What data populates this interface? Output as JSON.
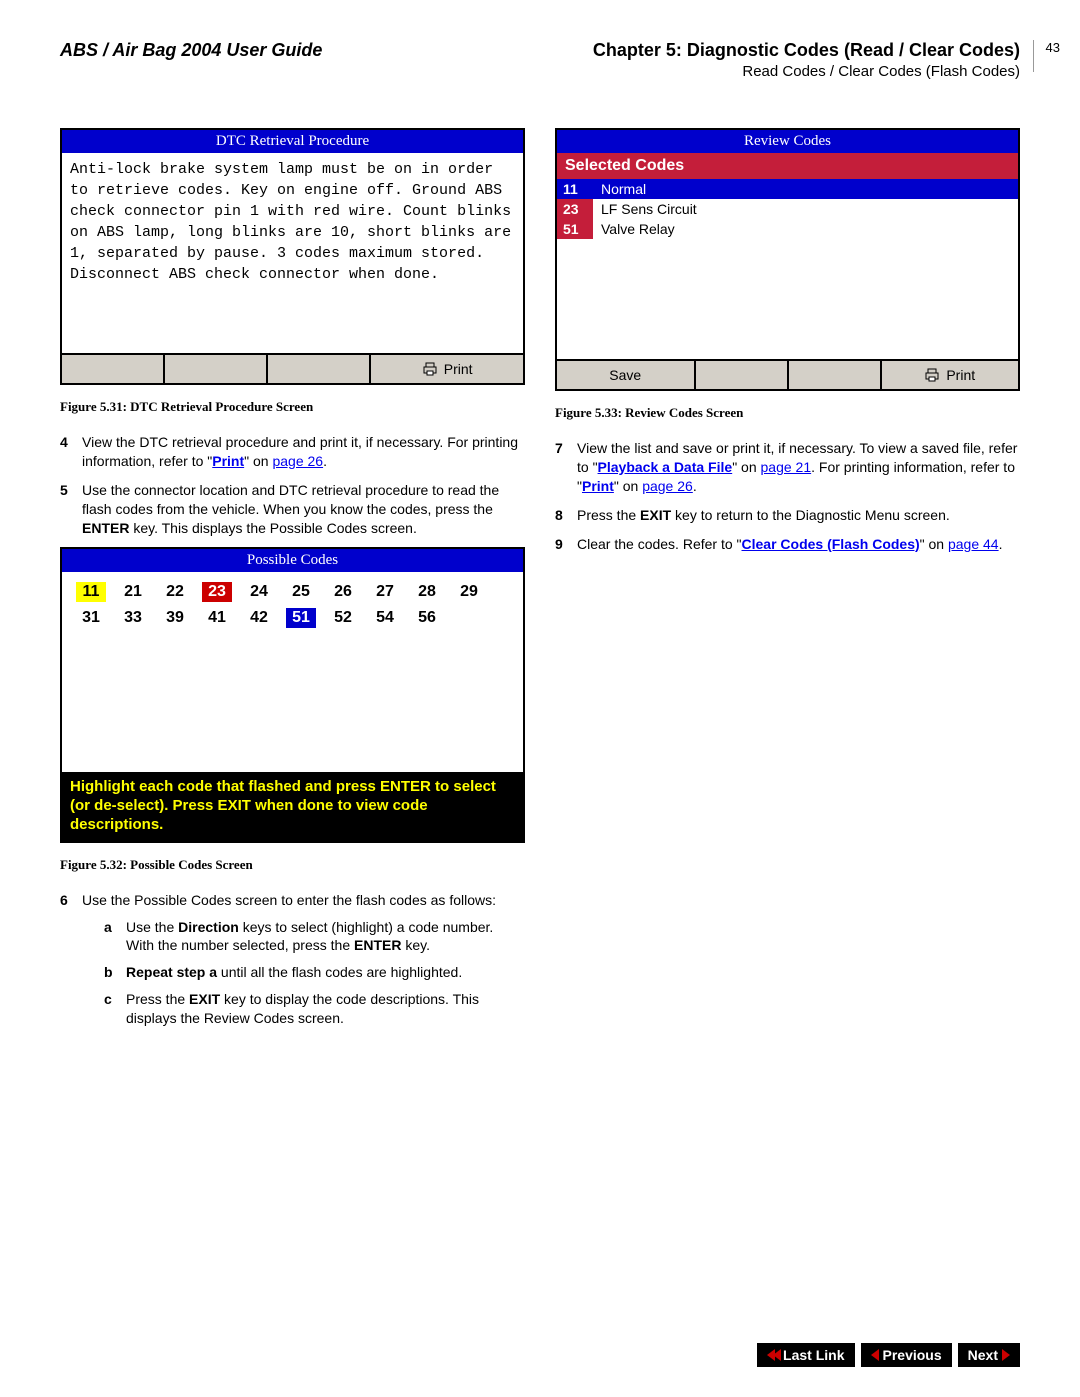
{
  "header": {
    "left": "ABS / Air Bag 2004 User Guide",
    "chapter": "Chapter 5: Diagnostic Codes (Read / Clear Codes)",
    "subtitle": "Read Codes / Clear Codes (Flash Codes)",
    "page_number": "43"
  },
  "screen_dtc": {
    "title": "DTC Retrieval Procedure",
    "body": "Anti-lock brake system lamp must be on in order to retrieve codes. Key on engine off. Ground ABS check connector pin 1 with red wire. Count blinks on ABS lamp, long blinks are 10, short blinks are 1, separated by pause. 3 codes maximum stored. Disconnect ABS check connector when done.",
    "print_label": "Print"
  },
  "fig531": "Figure 5.31: DTC Retrieval Procedure Screen",
  "step4": {
    "num": "4",
    "text_a": "View the DTC retrieval procedure and print it, if necessary. For printing information, refer to \"",
    "link": "Print",
    "text_b": "\" on ",
    "pagelink": "page 26",
    "text_c": "."
  },
  "step5": {
    "num": "5",
    "text": "Use the connector location and DTC retrieval procedure to read the flash codes from the vehicle. When you know the codes, press the ",
    "bold": "ENTER",
    "text2": " key. This displays the Possible Codes screen."
  },
  "screen_possible": {
    "title": "Possible Codes",
    "codes": [
      {
        "v": "11",
        "h": "y"
      },
      {
        "v": "21",
        "h": ""
      },
      {
        "v": "22",
        "h": ""
      },
      {
        "v": "23",
        "h": "r"
      },
      {
        "v": "24",
        "h": ""
      },
      {
        "v": "25",
        "h": ""
      },
      {
        "v": "26",
        "h": ""
      },
      {
        "v": "27",
        "h": ""
      },
      {
        "v": "28",
        "h": ""
      },
      {
        "v": "29",
        "h": ""
      },
      {
        "v": "31",
        "h": ""
      },
      {
        "v": "33",
        "h": ""
      },
      {
        "v": "39",
        "h": ""
      },
      {
        "v": "41",
        "h": ""
      },
      {
        "v": "42",
        "h": ""
      },
      {
        "v": "51",
        "h": "b"
      },
      {
        "v": "52",
        "h": ""
      },
      {
        "v": "54",
        "h": ""
      },
      {
        "v": "56",
        "h": ""
      }
    ],
    "instruction": "Highlight each code that flashed and press ENTER to select (or de-select). Press EXIT when done to view code descriptions."
  },
  "fig532": "Figure 5.32: Possible Codes Screen",
  "step6": {
    "num": "6",
    "text": "Use the Possible Codes screen to enter the flash codes as follows:",
    "a": {
      "letter": "a",
      "t1": "Use the ",
      "b1": "Direction",
      "t2": " keys to select (highlight) a code number. With the number selected, press the ",
      "b2": "ENTER",
      "t3": " key."
    },
    "b": {
      "letter": "b",
      "b1": "Repeat step a",
      "t1": " until all the flash codes are highlighted."
    },
    "c": {
      "letter": "c",
      "t1": "Press the ",
      "b1": "EXIT",
      "t2": " key to display the code descriptions. This displays the Review Codes screen."
    }
  },
  "screen_review": {
    "title": "Review Codes",
    "selected_label": "Selected Codes",
    "rows": [
      {
        "code": "11",
        "bg": "b",
        "desc": "Normal",
        "descbg": "b"
      },
      {
        "code": "23",
        "bg": "r",
        "desc": "LF Sens Circuit",
        "descbg": ""
      },
      {
        "code": "51",
        "bg": "r",
        "desc": "Valve Relay",
        "descbg": ""
      }
    ],
    "save_label": "Save",
    "print_label": "Print"
  },
  "fig533": "Figure 5.33: Review Codes Screen",
  "step7": {
    "num": "7",
    "t1": "View the list and save or print it, if necessary. To view a saved file, refer to \"",
    "link1": "Playback a Data File",
    "t2": "\" on ",
    "page1": "page 21",
    "t3": ". For printing information, refer to \"",
    "link2": "Print",
    "t4": "\" on ",
    "page2": "page 26",
    "t5": "."
  },
  "step8": {
    "num": "8",
    "t1": "Press the ",
    "b1": "EXIT",
    "t2": " key to return to the Diagnostic Menu screen."
  },
  "step9": {
    "num": "9",
    "t1": "Clear the codes. Refer to \"",
    "link": "Clear Codes (Flash Codes)",
    "t2": "\" on ",
    "page": "page 44",
    "t3": "."
  },
  "nav": {
    "lastlink": "Last Link",
    "previous": "Previous",
    "next": "Next"
  }
}
